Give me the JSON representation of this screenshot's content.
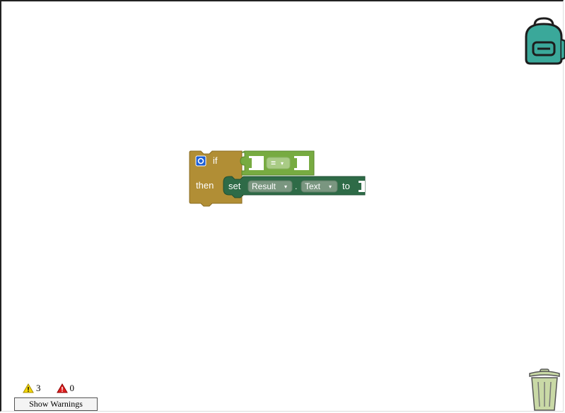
{
  "blocks": {
    "if_block": {
      "if_label": "if",
      "then_label": "then",
      "color": "#b18e35"
    },
    "compare_block": {
      "operator": "=",
      "color": "#77ab41"
    },
    "set_block": {
      "set_label": "set",
      "component": "Result",
      "dot": ".",
      "property": "Text",
      "to_label": "to",
      "color": "#2e6b47"
    }
  },
  "warnings": {
    "warning_count": "3",
    "error_count": "0",
    "show_warnings_label": "Show Warnings"
  },
  "icons": {
    "backpack": "backpack-icon",
    "trash": "trash-can-icon",
    "mutator": "gear-icon",
    "warning": "warning-triangle-icon",
    "error": "error-triangle-icon"
  },
  "colors": {
    "backpack_fill": "#3aa89a",
    "trash_fill": "#c9d9a6",
    "warning_yellow": "#f5d90a",
    "error_red": "#e02020"
  }
}
